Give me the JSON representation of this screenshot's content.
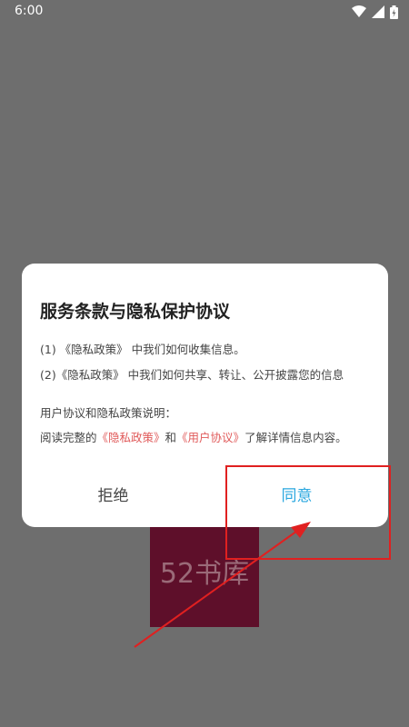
{
  "status_bar": {
    "time": "6:00"
  },
  "background": {
    "logo_text": "52书库"
  },
  "dialog": {
    "title": "服务条款与隐私保护协议",
    "line1": "(1) 《隐私政策》 中我们如何收集信息。",
    "line2": "(2)《隐私政策》 中我们如何共享、转让、公开披露您的信息",
    "line3": "用户协议和隐私政策说明：",
    "line4_prefix": "阅读完整的",
    "line4_privacy_link": "《隐私政策》",
    "line4_and": "和",
    "line4_user_link": "《用户协议》",
    "line4_suffix": "了解详情信息内容。",
    "reject_label": "拒绝",
    "agree_label": "同意"
  },
  "colors": {
    "background": "#6e6e6e",
    "logo_bg": "#5e0f2a",
    "link": "#e05a5a",
    "agree": "#2aa7df",
    "highlight": "#e02020"
  }
}
